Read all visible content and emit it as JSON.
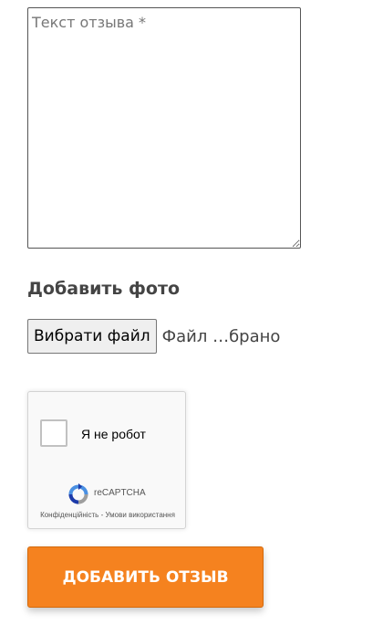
{
  "review": {
    "placeholder": "Текст отзыва *",
    "value": ""
  },
  "photo": {
    "heading": "Добавить фото",
    "choose_button": "Вибрати файл",
    "status": "Файл …брано"
  },
  "recaptcha": {
    "checkbox_label": "Я не робот",
    "brand": "reCAPTCHA",
    "privacy_link": "Конфіденційність",
    "separator": " - ",
    "terms_link": "Умови використання"
  },
  "submit": {
    "label": "ДОБАВИТЬ ОТЗЫВ"
  },
  "colors": {
    "accent": "#f5821f",
    "heading": "#444444"
  }
}
